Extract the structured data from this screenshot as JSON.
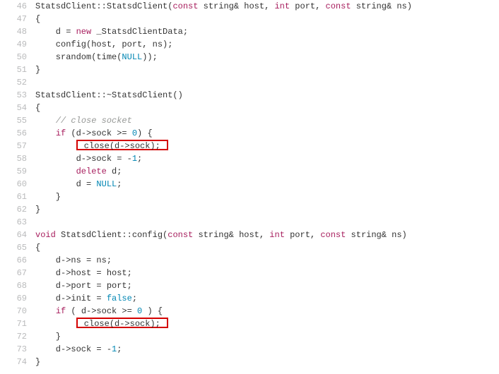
{
  "lines": [
    {
      "num": "46",
      "tokens": [
        {
          "t": "StatsdClient::StatsdClient(",
          "c": "plain"
        },
        {
          "t": "const",
          "c": "kw"
        },
        {
          "t": " string& host, ",
          "c": "plain"
        },
        {
          "t": "int",
          "c": "kw"
        },
        {
          "t": " port, ",
          "c": "plain"
        },
        {
          "t": "const",
          "c": "kw"
        },
        {
          "t": " string& ns)",
          "c": "plain"
        }
      ]
    },
    {
      "num": "47",
      "tokens": [
        {
          "t": "{",
          "c": "plain"
        }
      ]
    },
    {
      "num": "48",
      "tokens": [
        {
          "t": "    d = ",
          "c": "plain"
        },
        {
          "t": "new",
          "c": "kw"
        },
        {
          "t": " _StatsdClientData;",
          "c": "plain"
        }
      ]
    },
    {
      "num": "49",
      "tokens": [
        {
          "t": "    config(host, port, ns);",
          "c": "plain"
        }
      ]
    },
    {
      "num": "50",
      "tokens": [
        {
          "t": "    srandom(time(",
          "c": "plain"
        },
        {
          "t": "NULL",
          "c": "null"
        },
        {
          "t": "));",
          "c": "plain"
        }
      ]
    },
    {
      "num": "51",
      "tokens": [
        {
          "t": "}",
          "c": "plain"
        }
      ]
    },
    {
      "num": "52",
      "tokens": []
    },
    {
      "num": "53",
      "tokens": [
        {
          "t": "StatsdClient::~StatsdClient()",
          "c": "plain"
        }
      ]
    },
    {
      "num": "54",
      "tokens": [
        {
          "t": "{",
          "c": "plain"
        }
      ]
    },
    {
      "num": "55",
      "tokens": [
        {
          "t": "    ",
          "c": "plain"
        },
        {
          "t": "// close socket",
          "c": "com"
        }
      ]
    },
    {
      "num": "56",
      "tokens": [
        {
          "t": "    ",
          "c": "plain"
        },
        {
          "t": "if",
          "c": "kw"
        },
        {
          "t": " (d->sock >= ",
          "c": "plain"
        },
        {
          "t": "0",
          "c": "num"
        },
        {
          "t": ") {",
          "c": "plain"
        }
      ]
    },
    {
      "num": "57",
      "hl": true,
      "tokens": [
        {
          "t": "        ",
          "c": "plain"
        },
        {
          "t": " close(d->sock); ",
          "c": "plain",
          "boxed": true
        }
      ]
    },
    {
      "num": "58",
      "tokens": [
        {
          "t": "        d->sock = -",
          "c": "plain"
        },
        {
          "t": "1",
          "c": "num"
        },
        {
          "t": ";",
          "c": "plain"
        }
      ]
    },
    {
      "num": "59",
      "tokens": [
        {
          "t": "        ",
          "c": "plain"
        },
        {
          "t": "delete",
          "c": "kw"
        },
        {
          "t": " d;",
          "c": "plain"
        }
      ]
    },
    {
      "num": "60",
      "tokens": [
        {
          "t": "        d = ",
          "c": "plain"
        },
        {
          "t": "NULL",
          "c": "null"
        },
        {
          "t": ";",
          "c": "plain"
        }
      ]
    },
    {
      "num": "61",
      "tokens": [
        {
          "t": "    }",
          "c": "plain"
        }
      ]
    },
    {
      "num": "62",
      "tokens": [
        {
          "t": "}",
          "c": "plain"
        }
      ]
    },
    {
      "num": "63",
      "tokens": []
    },
    {
      "num": "64",
      "tokens": [
        {
          "t": "void",
          "c": "kw"
        },
        {
          "t": " StatsdClient::config(",
          "c": "plain"
        },
        {
          "t": "const",
          "c": "kw"
        },
        {
          "t": " string& host, ",
          "c": "plain"
        },
        {
          "t": "int",
          "c": "kw"
        },
        {
          "t": " port, ",
          "c": "plain"
        },
        {
          "t": "const",
          "c": "kw"
        },
        {
          "t": " string& ns)",
          "c": "plain"
        }
      ]
    },
    {
      "num": "65",
      "tokens": [
        {
          "t": "{",
          "c": "plain"
        }
      ]
    },
    {
      "num": "66",
      "tokens": [
        {
          "t": "    d->ns = ns;",
          "c": "plain"
        }
      ]
    },
    {
      "num": "67",
      "tokens": [
        {
          "t": "    d->host = host;",
          "c": "plain"
        }
      ]
    },
    {
      "num": "68",
      "tokens": [
        {
          "t": "    d->port = port;",
          "c": "plain"
        }
      ]
    },
    {
      "num": "69",
      "tokens": [
        {
          "t": "    d->init = ",
          "c": "plain"
        },
        {
          "t": "false",
          "c": "bool"
        },
        {
          "t": ";",
          "c": "plain"
        }
      ]
    },
    {
      "num": "70",
      "tokens": [
        {
          "t": "    ",
          "c": "plain"
        },
        {
          "t": "if",
          "c": "kw"
        },
        {
          "t": " ( d->sock >= ",
          "c": "plain"
        },
        {
          "t": "0",
          "c": "num"
        },
        {
          "t": " ) {",
          "c": "plain"
        }
      ]
    },
    {
      "num": "71",
      "hl": true,
      "tokens": [
        {
          "t": "        ",
          "c": "plain"
        },
        {
          "t": " close(d->sock); ",
          "c": "plain",
          "boxed": true
        }
      ]
    },
    {
      "num": "72",
      "tokens": [
        {
          "t": "    }",
          "c": "plain"
        }
      ]
    },
    {
      "num": "73",
      "tokens": [
        {
          "t": "    d->sock = -",
          "c": "plain"
        },
        {
          "t": "1",
          "c": "num"
        },
        {
          "t": ";",
          "c": "plain"
        }
      ]
    },
    {
      "num": "74",
      "tokens": [
        {
          "t": "}",
          "c": "plain"
        }
      ]
    }
  ]
}
